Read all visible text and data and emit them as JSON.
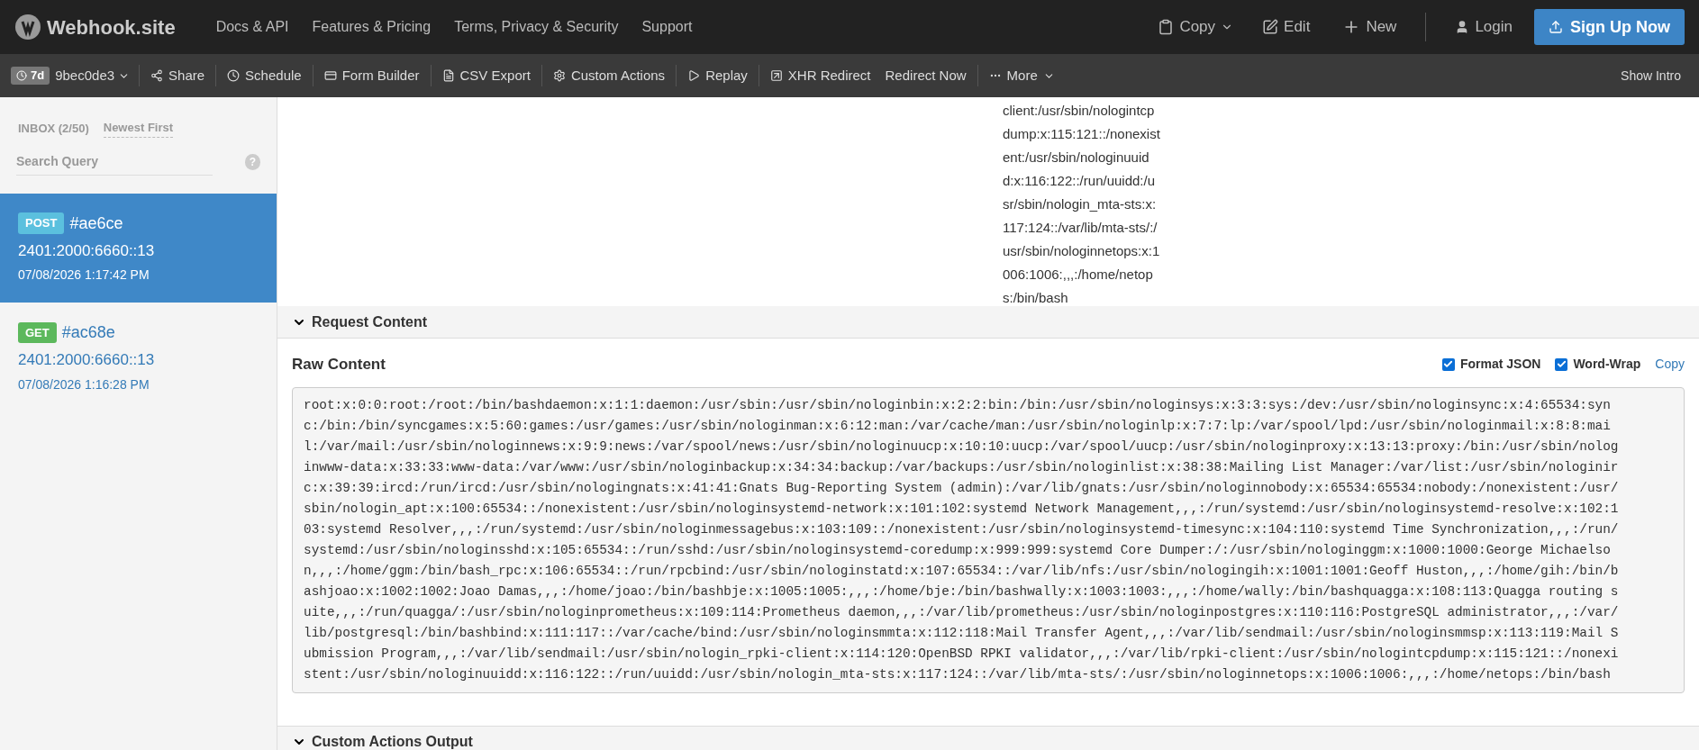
{
  "header": {
    "logo": "Webhook.site",
    "nav": [
      "Docs & API",
      "Features & Pricing",
      "Terms, Privacy & Security",
      "Support"
    ],
    "copy": "Copy",
    "edit": "Edit",
    "new": "New",
    "login": "Login",
    "signup": "Sign Up Now"
  },
  "toolbar": {
    "expiry": "7d",
    "token": "9bec0de3",
    "items": [
      "Share",
      "Schedule",
      "Form Builder",
      "CSV Export",
      "Custom Actions",
      "Replay",
      "XHR Redirect",
      "Redirect Now",
      "More"
    ],
    "show_intro": "Show Intro"
  },
  "sidebar": {
    "inbox": "INBOX (2/50)",
    "sort": "Newest First",
    "search": {
      "placeholder": "Search Query"
    },
    "help": "?",
    "requests": [
      {
        "method": "POST",
        "id": "#ae6ce",
        "ip": "2401:2000:6660::13",
        "time": "07/08/2026 1:17:42 PM",
        "selected": true
      },
      {
        "method": "GET",
        "id": "#ac68e",
        "ip": "2401:2000:6660::13",
        "time": "07/08/2026 1:16:28 PM",
        "selected": false
      }
    ]
  },
  "column_text": [
    "client:/usr/sbin/nologintcp",
    "dump:x:115:121::/nonexist",
    "ent:/usr/sbin/nologinuuid",
    "d:x:116:122::/run/uuidd:/u",
    "sr/sbin/nologin_mta-sts:x:",
    "117:124::/var/lib/mta-sts/:/",
    "usr/sbin/nologinnetops:x:1",
    "006:1006:,,,:/home/netop",
    "s:/bin/bash"
  ],
  "request_content": {
    "title": "Request Content",
    "raw_title": "Raw Content",
    "format_json": {
      "label": "Format JSON",
      "checked": true
    },
    "word_wrap": {
      "label": "Word-Wrap",
      "checked": true
    },
    "copy": "Copy",
    "raw_lines": [
      "root:x:0:0:root:/root:/bin/bashdaemon:x:1:1:daemon:/usr/sbin:/usr/sbin/nologinbin:x:2:2:bin:/bin:/usr/sbin/nologinsys:x:3:3:sys:/dev:/usr/sbin/nologinsync:x:4:65534:syn",
      "c:/bin:/bin/syncgames:x:5:60:games:/usr/games:/usr/sbin/nologinman:x:6:12:man:/var/cache/man:/usr/sbin/nologinlp:x:7:7:lp:/var/spool/lpd:/usr/sbin/nologinmail:x:8:8:mai",
      "l:/var/mail:/usr/sbin/nologinnews:x:9:9:news:/var/spool/news:/usr/sbin/nologinuucp:x:10:10:uucp:/var/spool/uucp:/usr/sbin/nologinproxy:x:13:13:proxy:/bin:/usr/sbin/nolog",
      "inwww-data:x:33:33:www-data:/var/www:/usr/sbin/nologinbackup:x:34:34:backup:/var/backups:/usr/sbin/nologinlist:x:38:38:Mailing List Manager:/var/list:/usr/sbin/nologinir",
      "c:x:39:39:ircd:/run/ircd:/usr/sbin/nologingnats:x:41:41:Gnats Bug-Reporting System (admin):/var/lib/gnats:/usr/sbin/nologinnobody:x:65534:65534:nobody:/nonexistent:/usr/",
      "sbin/nologin_apt:x:100:65534::/nonexistent:/usr/sbin/nologinsystemd-network:x:101:102:systemd Network Management,,,:/run/systemd:/usr/sbin/nologinsystemd-resolve:x:102:1",
      "03:systemd Resolver,,,:/run/systemd:/usr/sbin/nologinmessagebus:x:103:109::/nonexistent:/usr/sbin/nologinsystemd-timesync:x:104:110:systemd Time Synchronization,,,:/run/",
      "systemd:/usr/sbin/nologinsshd:x:105:65534::/run/sshd:/usr/sbin/nologinsystemd-coredump:x:999:999:systemd Core Dumper:/:/usr/sbin/nologinggm:x:1000:1000:George Michaelso",
      "n,,,:/home/ggm:/bin/bash_rpc:x:106:65534::/run/rpcbind:/usr/sbin/nologinstatd:x:107:65534::/var/lib/nfs:/usr/sbin/nologingih:x:1001:1001:Geoff Huston,,,:/home/gih:/bin/b",
      "ashjoao:x:1002:1002:Joao Damas,,,:/home/joao:/bin/bashbje:x:1005:1005:,,,:/home/bje:/bin/bashwally:x:1003:1003:,,,:/home/wally:/bin/bashquagga:x:108:113:Quagga routing s",
      "uite,,,:/run/quagga/:/usr/sbin/nologinprometheus:x:109:114:Prometheus daemon,,,:/var/lib/prometheus:/usr/sbin/nologinpostgres:x:110:116:PostgreSQL administrator,,,:/var/",
      "lib/postgresql:/bin/bashbind:x:111:117::/var/cache/bind:/usr/sbin/nologinsmmta:x:112:118:Mail Transfer Agent,,,:/var/lib/sendmail:/usr/sbin/nologinsmmsp:x:113:119:Mail S",
      "ubmission Program,,,:/var/lib/sendmail:/usr/sbin/nologin_rpki-client:x:114:120:OpenBSD RPKI validator,,,:/var/lib/rpki-client:/usr/sbin/nologintcpdump:x:115:121::/nonexi",
      "stent:/usr/sbin/nologinuuidd:x:116:122::/run/uuidd:/usr/sbin/nologin_mta-sts:x:117:124::/var/lib/mta-sts/:/usr/sbin/nologinnetops:x:1006:1006:,,,:/home/netops:/bin/bash"
    ]
  },
  "custom_actions": {
    "title": "Custom Actions Output"
  }
}
